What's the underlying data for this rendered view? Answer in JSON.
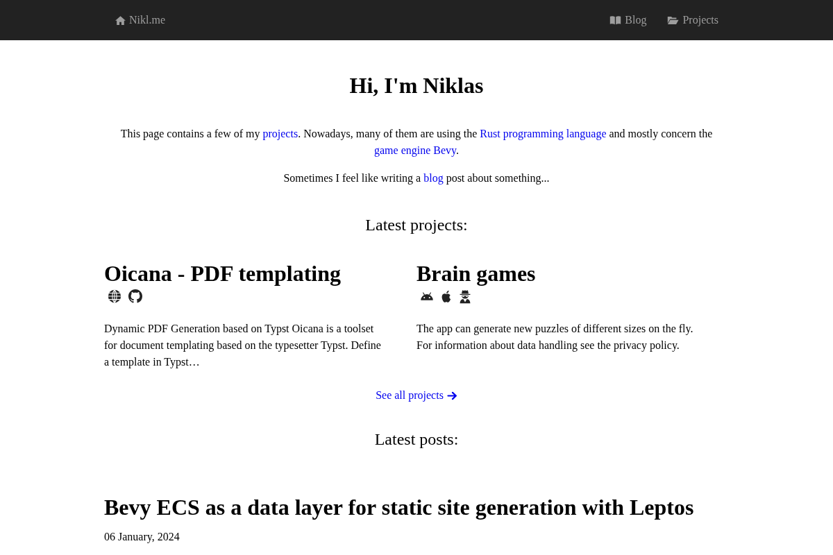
{
  "nav": {
    "brand": "Nikl.me",
    "links": [
      {
        "label": "Blog"
      },
      {
        "label": "Projects"
      }
    ]
  },
  "intro": {
    "heading": "Hi, I'm Niklas",
    "paragraphs": [
      [
        {
          "kind": "text",
          "text": "This page contains a few of my "
        },
        {
          "kind": "link",
          "text": "projects"
        },
        {
          "kind": "text",
          "text": ". Nowadays, many of them are using the "
        },
        {
          "kind": "link",
          "text": "Rust programming language"
        },
        {
          "kind": "text",
          "text": " and mostly concern the "
        },
        {
          "kind": "link",
          "text": "game engine Bevy"
        },
        {
          "kind": "text",
          "text": "."
        }
      ],
      [
        {
          "kind": "text",
          "text": "Sometimes I feel like writing a "
        },
        {
          "kind": "link",
          "text": "blog"
        },
        {
          "kind": "text",
          "text": " post about something..."
        }
      ]
    ]
  },
  "projects": {
    "heading": "Latest projects:",
    "items": [
      {
        "title": "Oicana - PDF templating",
        "links": [
          {
            "kind": "website"
          },
          {
            "kind": "github"
          }
        ],
        "description": "Dynamic PDF Generation based on Typst Oicana is a toolset for document templating based on the typesetter Typst. Define a template in Typst…"
      },
      {
        "title": "Brain games",
        "links": [
          {
            "kind": "android"
          },
          {
            "kind": "ios"
          },
          {
            "kind": "privacy"
          }
        ],
        "description": "The app can generate new puzzles of different sizes on the fly. For information about data handling see the privacy policy."
      }
    ],
    "see_all": "See all projects"
  },
  "posts": {
    "heading": "Latest posts:",
    "items": [
      {
        "title": "Bevy ECS as a data layer for static site generation with Leptos",
        "date": "06 January, 2024"
      }
    ]
  }
}
